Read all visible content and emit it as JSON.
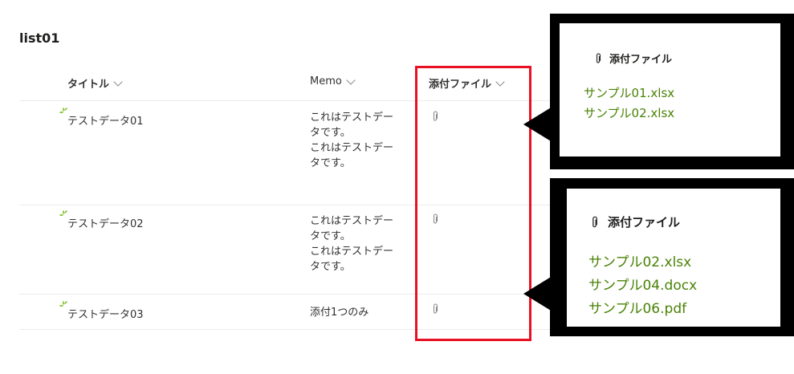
{
  "list_title": "list01",
  "columns": [
    {
      "label": "タイトル"
    },
    {
      "label": "Memo"
    },
    {
      "label": "添付ファイル"
    }
  ],
  "rows": [
    {
      "title": "テストデータ01",
      "memo": [
        "これはテストデー",
        "タです。",
        "これはテストデー",
        "タです。"
      ]
    },
    {
      "title": "テストデータ02",
      "memo": [
        "これはテストデー",
        "タです。",
        "これはテストデー",
        "タです。"
      ]
    },
    {
      "title": "テストデータ03",
      "memo": [
        "添付1つのみ"
      ]
    }
  ],
  "callout1": {
    "header": "添付ファイル",
    "files": [
      "サンプル01.xlsx",
      "サンプル02.xlsx"
    ]
  },
  "callout2": {
    "header": "添付ファイル",
    "files": [
      "サンプル02.xlsx",
      "サンプル04.docx",
      "サンプル06.pdf"
    ]
  },
  "colors": {
    "highlight": "#e81123",
    "link": "#498205",
    "new_mark": "#6bb700"
  },
  "icons": {
    "attachment": "paperclip-icon",
    "new": "new-item-icon",
    "sort": "chevron-down-icon"
  }
}
